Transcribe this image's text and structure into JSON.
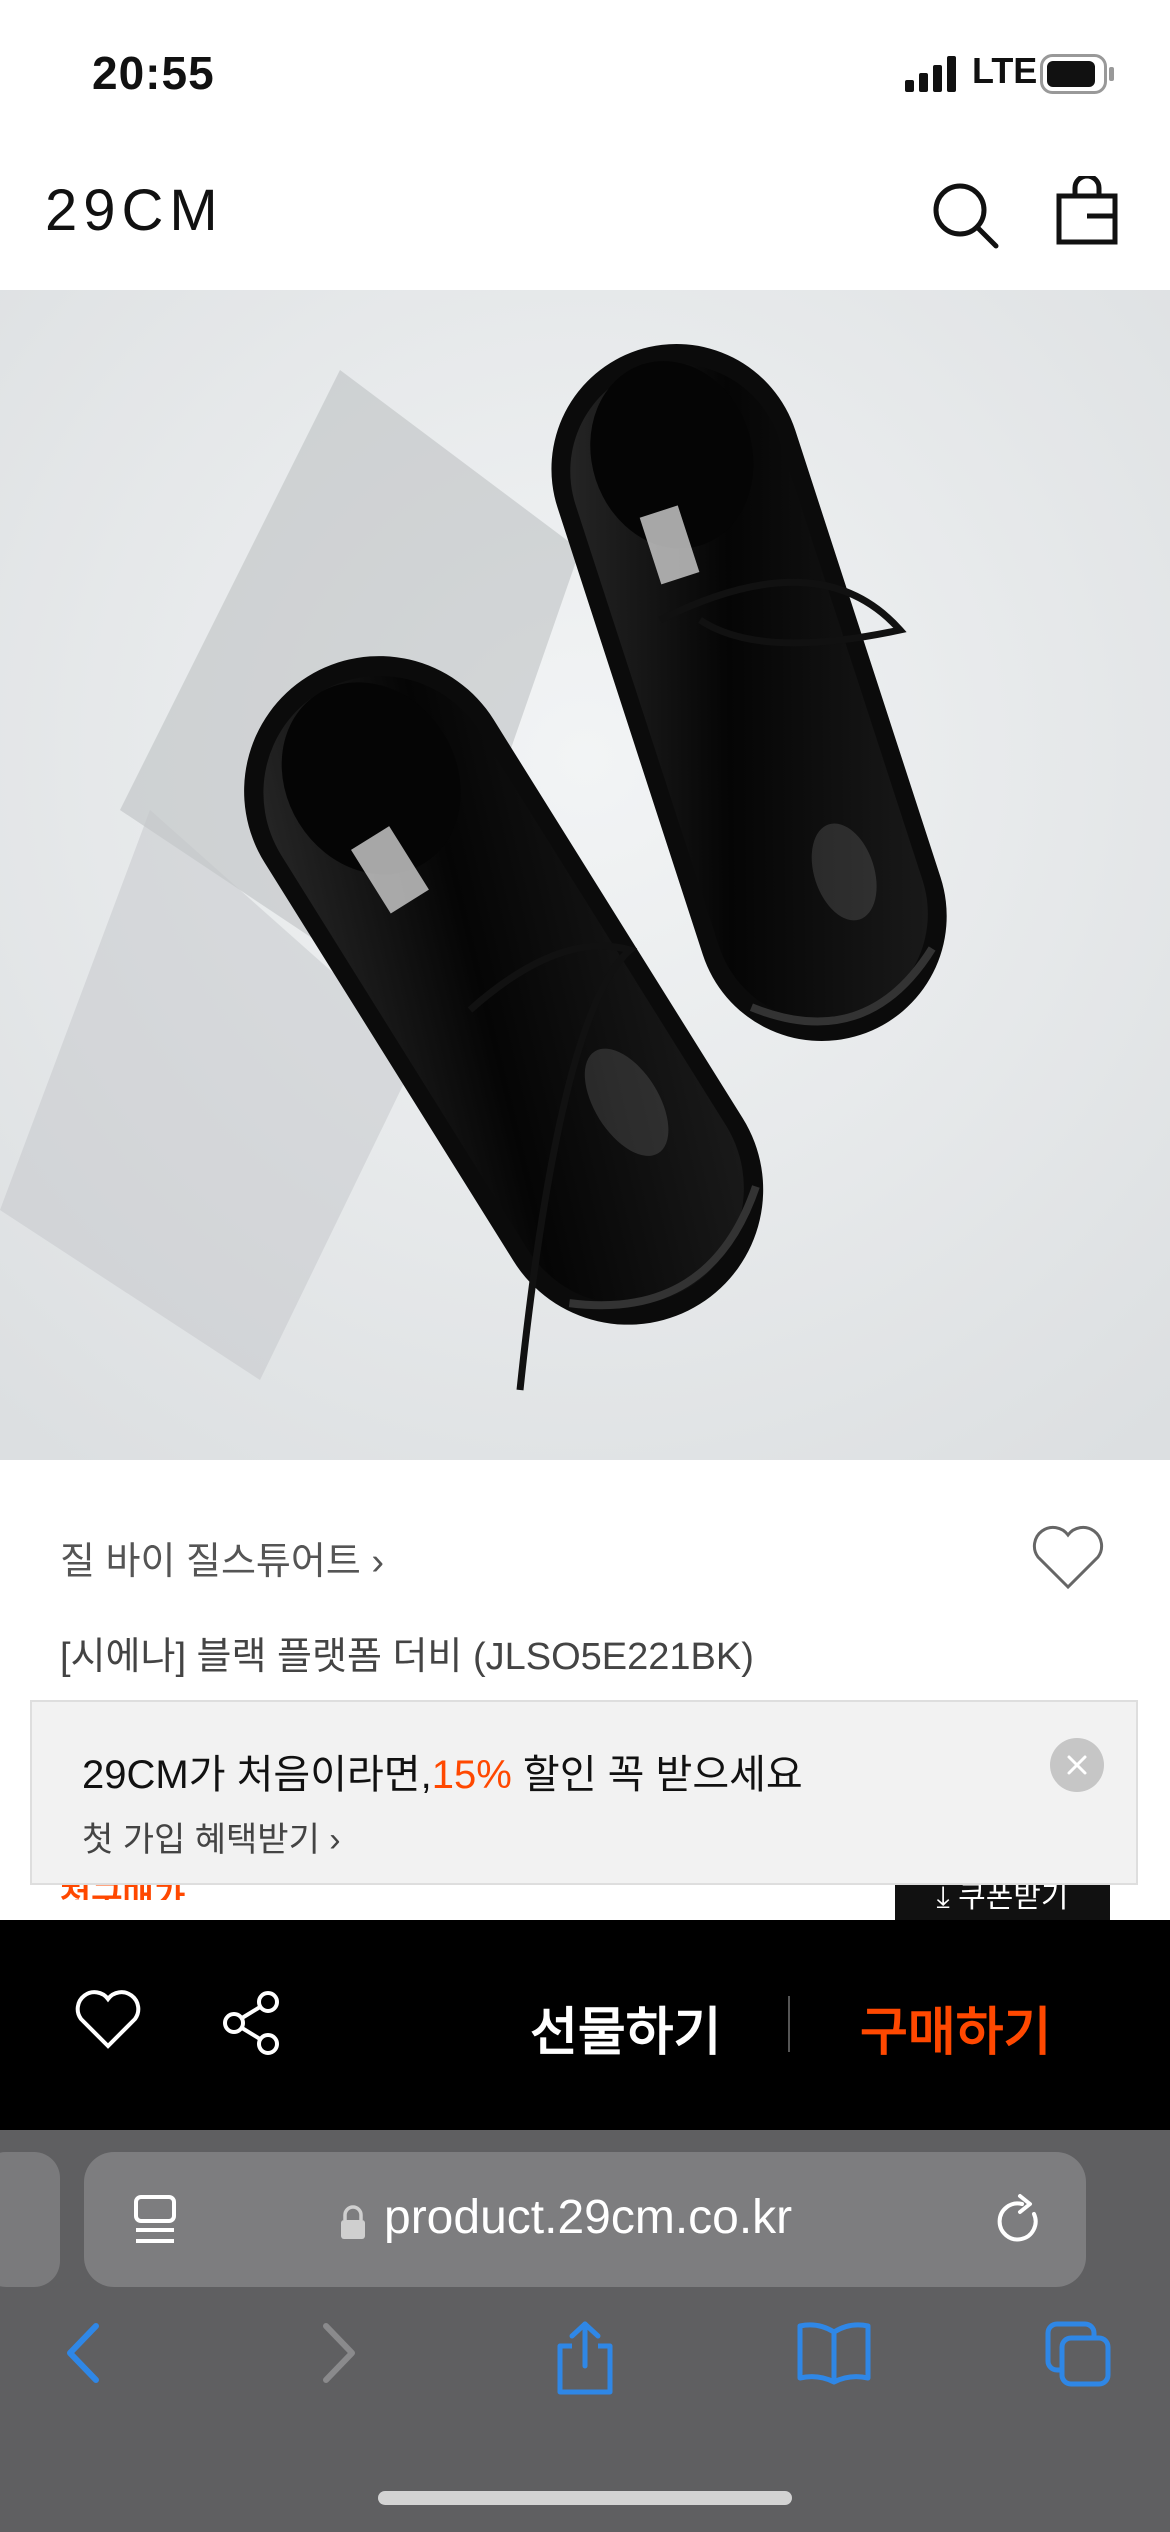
{
  "status_bar": {
    "time": "20:55",
    "network": "LTE"
  },
  "header": {
    "logo": "29CM"
  },
  "product": {
    "brand": "질 바이 질스튜어트",
    "title": "[시에나] 블랙 플랫폼 더비 (JLSO5E221BK)",
    "partial_label": "첫구매가",
    "coupon_label": "쿠폰받기"
  },
  "promo": {
    "headline_prefix": "29CM가 처음이라면,",
    "headline_highlight": "15%",
    "headline_suffix": " 할인 꼭 받으세요",
    "sub": "첫 가입 혜택받기"
  },
  "action_bar": {
    "gift_label": "선물하기",
    "buy_label": "구매하기"
  },
  "browser": {
    "url": "product.29cm.co.kr"
  },
  "colors": {
    "accent": "#ff4800",
    "bar_bg": "#000000",
    "chrome_bg": "#5f5f61",
    "link_blue": "#2f87e6"
  }
}
